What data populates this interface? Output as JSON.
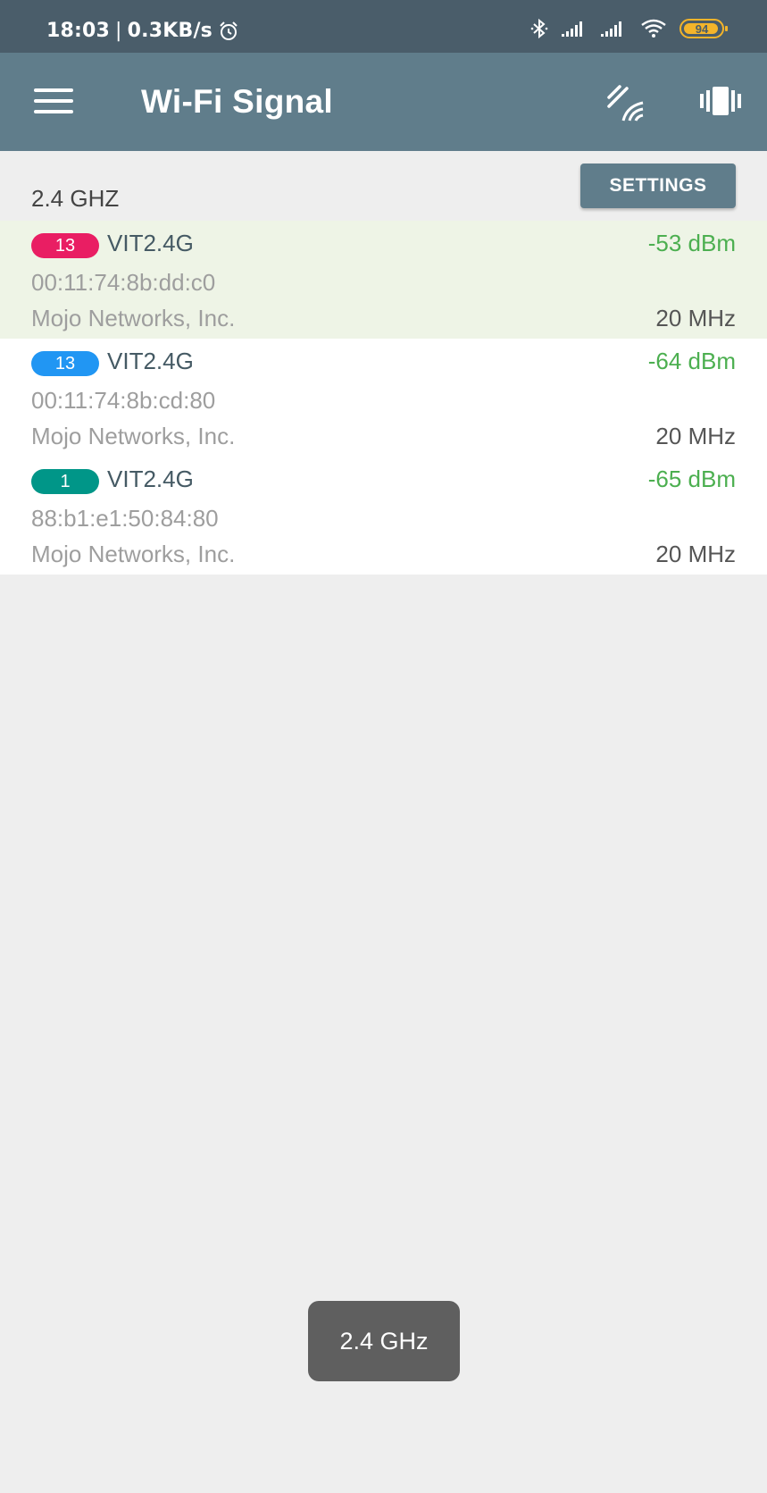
{
  "status_bar": {
    "time": "18:03",
    "separator": "|",
    "net_speed": "0.3KB/s",
    "battery_level": "94",
    "icons": [
      "alarm-icon",
      "bluetooth-icon",
      "signal-icon",
      "signal-icon",
      "wifi-icon",
      "battery-icon"
    ]
  },
  "app_bar": {
    "title": "Wi-Fi Signal",
    "menu_icon": "hamburger-menu-icon",
    "actions": [
      "wifi-signal-icon",
      "vibrate-icon"
    ]
  },
  "band": {
    "label": "2.4 GHZ",
    "settings_label": "SETTINGS"
  },
  "networks": [
    {
      "channel": "13",
      "channel_color": "#e91e63",
      "ssid": "VIT2.4G",
      "rssi": "-53 dBm",
      "bssid": "00:11:74:8b:dd:c0",
      "vendor": "Mojo Networks, Inc.",
      "width": "20 MHz",
      "connected": true
    },
    {
      "channel": "13",
      "channel_color": "#2196f3",
      "ssid": "VIT2.4G",
      "rssi": "-64 dBm",
      "bssid": "00:11:74:8b:cd:80",
      "vendor": "Mojo Networks, Inc.",
      "width": "20 MHz",
      "connected": false
    },
    {
      "channel": "1",
      "channel_color": "#009688",
      "ssid": "VIT2.4G",
      "rssi": "-65 dBm",
      "bssid": "88:b1:e1:50:84:80",
      "vendor": "Mojo Networks, Inc.",
      "width": "20 MHz",
      "connected": false
    }
  ],
  "toast": {
    "text": "2.4 GHz"
  },
  "colors": {
    "status_bar": "#4a5d6a",
    "app_bar": "#607d8b",
    "background": "#eeeeee",
    "connected_row": "#eef4e6",
    "rssi": "#4caf50",
    "battery": "#f4b42a"
  }
}
